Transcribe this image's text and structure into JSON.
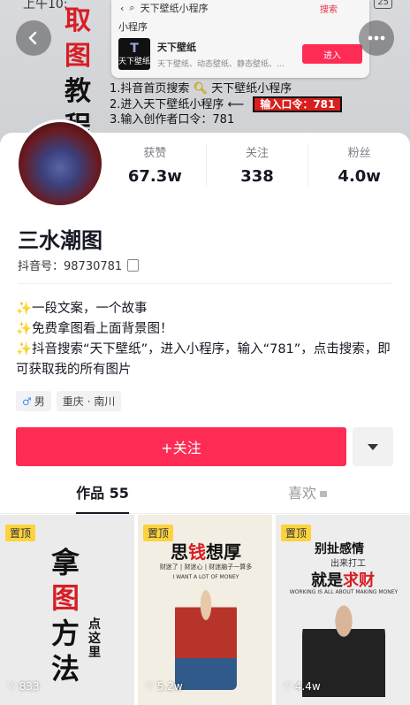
{
  "status": {
    "time": "上午10:",
    "battery": "25"
  },
  "banner": {
    "vertical_title": {
      "ch1": "取",
      "ch2": "图",
      "ch3": "教",
      "ch4": "程"
    },
    "search": {
      "query": "天下壁纸小程序",
      "action": "搜索"
    },
    "mini_program": {
      "section_label": "小程序",
      "icon_text": "天下壁纸",
      "name": "天下壁纸",
      "description": "天下壁纸、动态壁纸、静态壁纸、...",
      "enter_label": "进入"
    },
    "steps": [
      "1.抖音首页搜索",
      "天下壁纸小程序",
      "2.进入天下壁纸小程序",
      "3.输入创作者口令：781"
    ],
    "code_badge": "输入口令：781"
  },
  "profile": {
    "stats": [
      {
        "label": "获赞",
        "value": "67.3w"
      },
      {
        "label": "关注",
        "value": "338"
      },
      {
        "label": "粉丝",
        "value": "4.0w"
      }
    ],
    "name": "三水潮图",
    "douyin_id": "抖音号：98730781",
    "bio": [
      "✨一段文案，一个故事",
      "✨免费拿图看上面背景图！",
      "✨抖音搜索“天下壁纸”，进入小程序，输入“781”，点击搜索，即可获取我的所有图片"
    ],
    "tags": {
      "gender": "男",
      "gender_symbol": "♂",
      "location": "重庆 · 南川"
    },
    "follow_label": "+关注"
  },
  "tabs": [
    {
      "label": "作品 55"
    },
    {
      "label": "喜欢"
    }
  ],
  "videos": [
    {
      "pinned": "置顶",
      "likes": "833",
      "title_a": "拿",
      "title_b": "图",
      "title_c": "方",
      "title_d": "法",
      "side": "点这里"
    },
    {
      "pinned": "置顶",
      "likes": "5.2w",
      "title_a": "思",
      "title_b": "钱",
      "title_c": "想厚",
      "sub": "财迷了 | 财迷心 | 财迷脑子一算多",
      "en": "I WANT A LOT OF MONEY"
    },
    {
      "pinned": "置顶",
      "likes": "4.4w",
      "title": "别扯感情",
      "sub": "出来打工",
      "big_a": "就是",
      "big_b": "求财",
      "en": "WORKING IS ALL ABOUT MAKING MONEY"
    }
  ]
}
